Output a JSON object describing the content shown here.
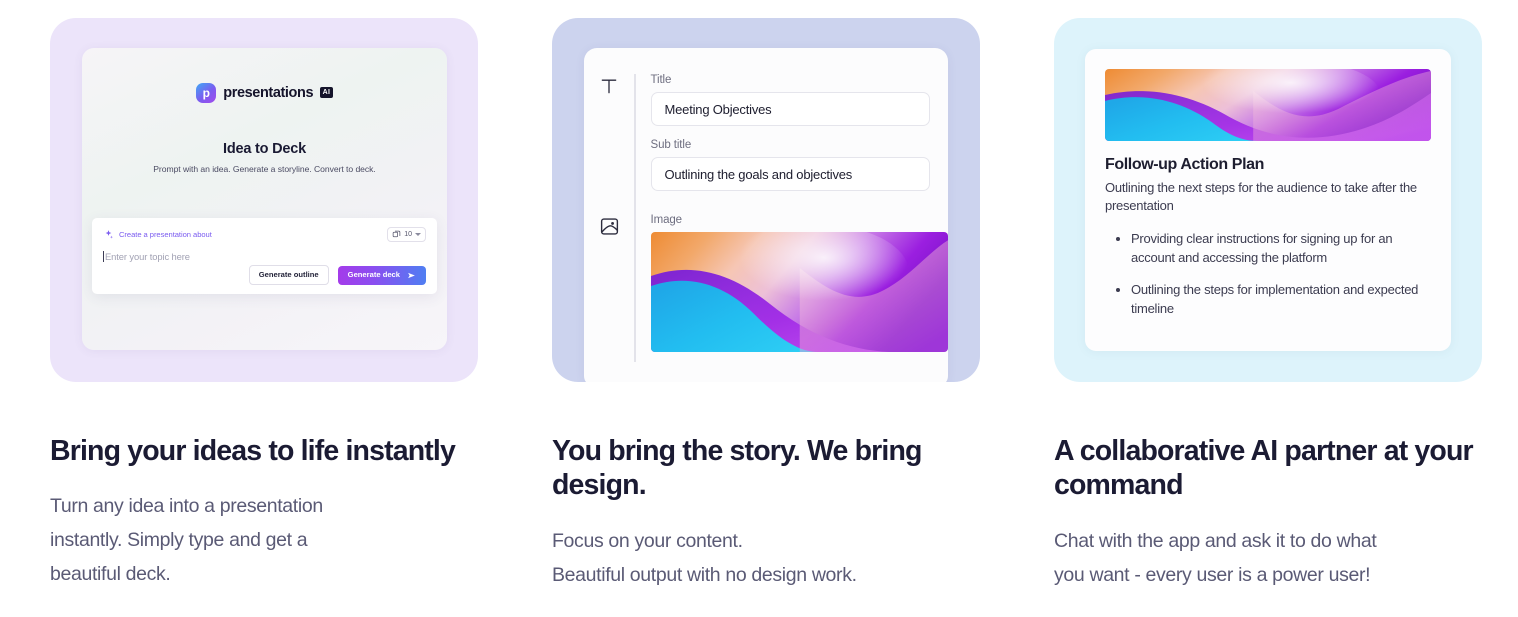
{
  "features": [
    {
      "tint": "tint-lavender",
      "title": "Bring your ideas to life instantly",
      "body_lines": [
        "Turn any idea into a presentation",
        "instantly. Simply type and get a",
        "beautiful deck."
      ],
      "app": {
        "logo_mark": "p",
        "logo_word": "presentations",
        "logo_badge": "AI",
        "hero_title": "Idea to Deck",
        "hero_sub": "Prompt with an idea. Generate a storyline. Convert to deck.",
        "prompt_chip": "Create a presentation about",
        "slides_count": "10",
        "input_placeholder": "Enter your topic here",
        "btn_outline": "Generate outline",
        "btn_primary": "Generate deck"
      }
    },
    {
      "tint": "tint-periwinkle",
      "title": "You bring the story. We bring design.",
      "body_lines": [
        "Focus on your content.",
        "Beautiful output with no design work."
      ],
      "editor": {
        "title_label": "Title",
        "title_value": "Meeting Objectives",
        "subtitle_label": "Sub title",
        "subtitle_value": "Outlining the goals and objectives",
        "image_label": "Image"
      }
    },
    {
      "tint": "tint-cyan",
      "title": "A collaborative AI partner at your command",
      "body_lines": [
        "Chat with the app and ask it to do what",
        "you want - every user is a power user!"
      ],
      "slide": {
        "heading": "Follow-up Action Plan",
        "subheading": "Outlining the next steps for the audience to take after the presentation",
        "bullets": [
          "Providing clear instructions for signing up for an account and accessing the platform",
          "Outlining the steps for implementation and expected timeline"
        ]
      }
    }
  ],
  "colors": {
    "heading": "#1b1b33",
    "body": "#5a5a75",
    "accent_purple": "#7b5cf0",
    "card_tint_1": "#ece4fa",
    "card_tint_2": "#ccd3ee",
    "card_tint_3": "#ddf3fb"
  }
}
